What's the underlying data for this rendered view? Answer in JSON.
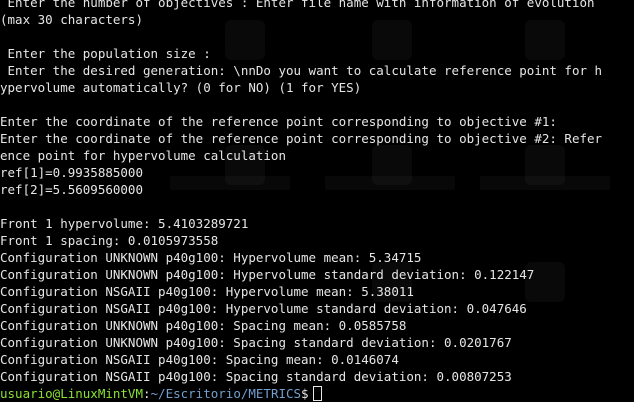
{
  "terminal": {
    "lines": [
      " Enter the number of objectives : Enter file name with information of evolution",
      "(max 30 characters)",
      "",
      " Enter the population size :",
      " Enter the desired generation: \\nnDo you want to calculate reference point for h",
      "ypervolume automatically? (0 for NO) (1 for YES)",
      "",
      "Enter the coordinate of the reference point corresponding to objective #1:",
      "Enter the coordinate of the reference point corresponding to objective #2: Refer",
      "ence point for hypervolume calculation",
      "ref[1]=0.9935885000",
      "ref[2]=5.5609560000",
      "",
      "Front 1 hypervolume: 5.4103289721",
      "Front 1 spacing: 0.0105973558",
      "Configuration UNKNOWN p40g100: Hypervolume mean: 5.34715",
      "Configuration UNKNOWN p40g100: Hypervolume standard deviation: 0.122147",
      "Configuration NSGAII p40g100: Hypervolume mean: 5.38011",
      "Configuration NSGAII p40g100: Hypervolume standard deviation: 0.047646",
      "Configuration UNKNOWN p40g100: Spacing mean: 0.0585758",
      "Configuration UNKNOWN p40g100: Spacing standard deviation: 0.0201767",
      "Configuration NSGAII p40g100: Spacing mean: 0.0146074",
      "Configuration NSGAII p40g100: Spacing standard deviation: 0.00807253"
    ],
    "prompt": {
      "user_host": "usuario@LinuxMintVM",
      "separator": ":",
      "path": "~/Escritorio/METRICS",
      "symbol": "$"
    }
  },
  "colors": {
    "background": "#000000",
    "text": "#e6e6e6",
    "prompt_user": "#8ae234",
    "prompt_path": "#729fcf"
  }
}
